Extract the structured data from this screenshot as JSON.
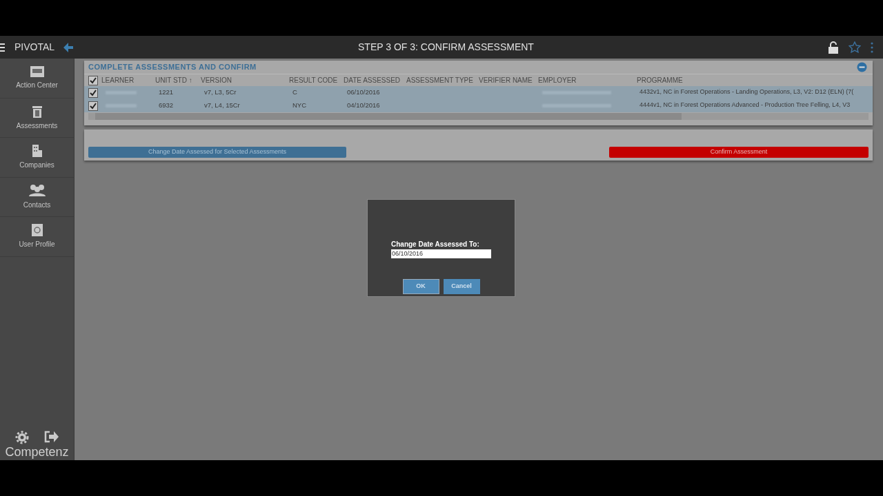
{
  "header": {
    "app_name": "PIVOTAL",
    "title": "STEP 3 OF 3: CONFIRM ASSESSMENT"
  },
  "sidebar": {
    "items": [
      {
        "label": "Action Center",
        "kind": "monitor"
      },
      {
        "label": "Assessments",
        "kind": "bin"
      },
      {
        "label": "Companies",
        "kind": "building"
      },
      {
        "label": "Contacts",
        "kind": "people"
      },
      {
        "label": "User Profile",
        "kind": "profile"
      }
    ],
    "brand": "Competenz"
  },
  "panel": {
    "title": "COMPLETE ASSESSMENTS AND CONFIRM",
    "select_all_checked": true,
    "columns": [
      "LEARNER",
      "UNIT STD ↑",
      "VERSION",
      "RESULT CODE",
      "DATE ASSESSED",
      "ASSESSMENT TYPE",
      "VERIFIER NAME",
      "EMPLOYER",
      "PROGRAMME"
    ],
    "rows": [
      {
        "checked": true,
        "unit_std": "1221",
        "version": "v7, L3, 5Cr",
        "result_code": "C",
        "date_assessed": "06/10/2016",
        "programme": "4432v1, NC in Forest Operations - Landing Operations, L3, V2: D12 (ELN) (7("
      },
      {
        "checked": true,
        "unit_std": "6932",
        "version": "v7, L4, 15Cr",
        "result_code": "NYC",
        "date_assessed": "04/10/2016",
        "programme": "4444v1, NC in Forest Operations Advanced - Production Tree Felling, L4, V3"
      }
    ]
  },
  "actions": {
    "change_date_button": "Change Date Assessed for Selected Assessments",
    "confirm_button": "Confirm Assessment"
  },
  "dialog": {
    "label": "Change Date Assessed To:",
    "value": "06/10/2016",
    "ok": "OK",
    "cancel": "Cancel"
  }
}
